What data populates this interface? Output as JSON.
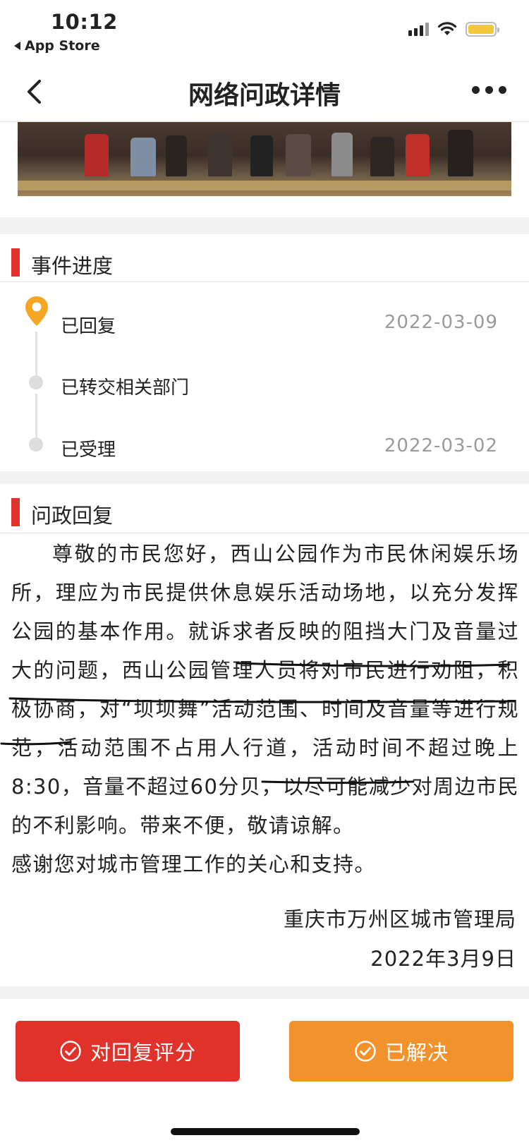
{
  "status_bar": {
    "time": "10:12",
    "back_app": "App Store"
  },
  "nav": {
    "title": "网络问政详情"
  },
  "progress_section": {
    "title": "事件进度",
    "items": [
      {
        "label": "已回复",
        "date": "2022-03-09",
        "current": true
      },
      {
        "label": "已转交相关部门",
        "date": ""
      },
      {
        "label": "已受理",
        "date": "2022-03-02"
      }
    ]
  },
  "reply_section": {
    "title": "问政回复",
    "body": "尊敬的市民您好，西山公园作为市民休闲娱乐场所，理应为市民提供休息娱乐活动场地，以充分发挥公园的基本作用。就诉求者反映的阻挡大门及音量过大的问题，西山公园管理人员将对市民进行劝阻，积极协商，对“坝坝舞”活动范围、时间及音量等进行规范，活动范围不占用人行道，活动时间不超过晚上8:30，音量不超过60分贝，以尽可能减少对周边市民的不利影响。带来不便，敬请谅解。",
    "thanks": "感谢您对城市管理工作的关心和支持。",
    "signature": "重庆市万州区城市管理局",
    "date": "2022年3月9日"
  },
  "actions": {
    "rate_label": "对回复评分",
    "resolved_label": "已解决"
  },
  "colors": {
    "accent_red": "#e0322a",
    "accent_orange": "#f2922d",
    "pin_yellow": "#f5a623"
  }
}
